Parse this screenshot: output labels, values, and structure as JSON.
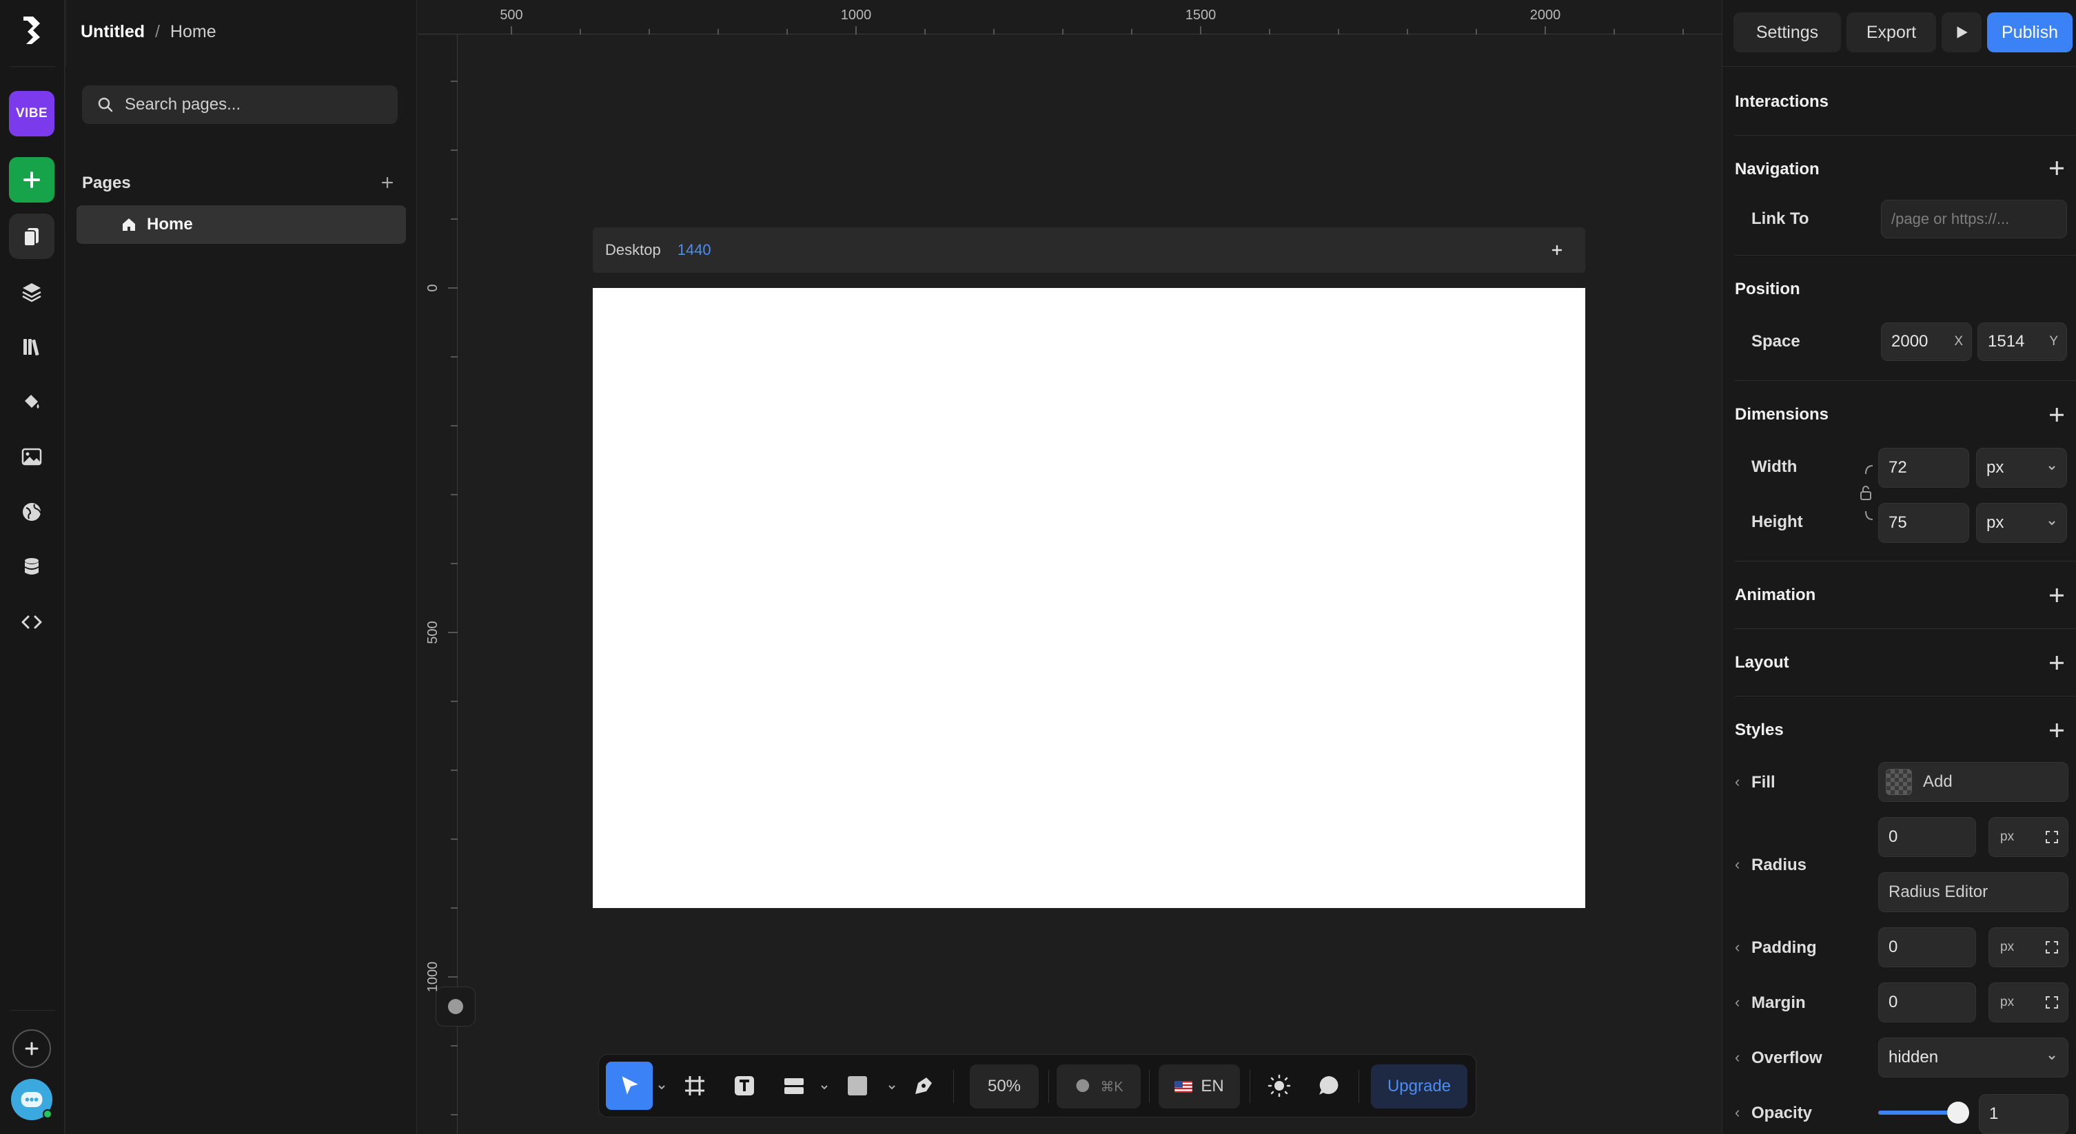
{
  "breadcrumb": {
    "project": "Untitled",
    "separator": "/",
    "page": "Home"
  },
  "rail": {
    "brand_badge": "VIBE"
  },
  "pages_panel": {
    "search_placeholder": "Search pages...",
    "section_title": "Pages",
    "pages": [
      {
        "label": "Home",
        "selected": true
      }
    ]
  },
  "canvas": {
    "ruler_top": [
      "500",
      "1000",
      "1500",
      "2000"
    ],
    "ruler_left": [
      "0",
      "500",
      "1000"
    ],
    "breakpoint_label": "Desktop",
    "breakpoint_width": "1440",
    "frame_color": "#ffffff"
  },
  "header_actions": {
    "settings": "Settings",
    "export": "Export",
    "publish": "Publish"
  },
  "props": {
    "interactions": "Interactions",
    "navigation": {
      "title": "Navigation",
      "link_label": "Link To",
      "link_placeholder": "/page or https://..."
    },
    "position": {
      "title": "Position",
      "label": "Space",
      "x_value": "2000",
      "x_suffix": "X",
      "y_value": "1514",
      "y_suffix": "Y"
    },
    "dimensions": {
      "title": "Dimensions",
      "width_label": "Width",
      "width_value": "72",
      "width_unit": "px",
      "height_label": "Height",
      "height_value": "75",
      "height_unit": "px"
    },
    "animation": "Animation",
    "layout": "Layout",
    "styles": {
      "title": "Styles",
      "fill_label": "Fill",
      "fill_value": "Add",
      "radius_label": "Radius",
      "radius_value": "0",
      "radius_unit": "px",
      "radius_editor": "Radius Editor",
      "padding_label": "Padding",
      "padding_value": "0",
      "padding_unit": "px",
      "margin_label": "Margin",
      "margin_value": "0",
      "margin_unit": "px",
      "overflow_label": "Overflow",
      "overflow_value": "hidden",
      "opacity_label": "Opacity",
      "opacity_value": "1",
      "opacity_level": 1
    }
  },
  "toolbar": {
    "zoom": "50%",
    "shortcut": "⌘K",
    "language": "EN",
    "upgrade": "Upgrade"
  },
  "colors": {
    "accent": "#3b82f6",
    "brand_badge": "#7c3aed",
    "add_button": "#16a34a",
    "background": "#1e1e1e"
  }
}
